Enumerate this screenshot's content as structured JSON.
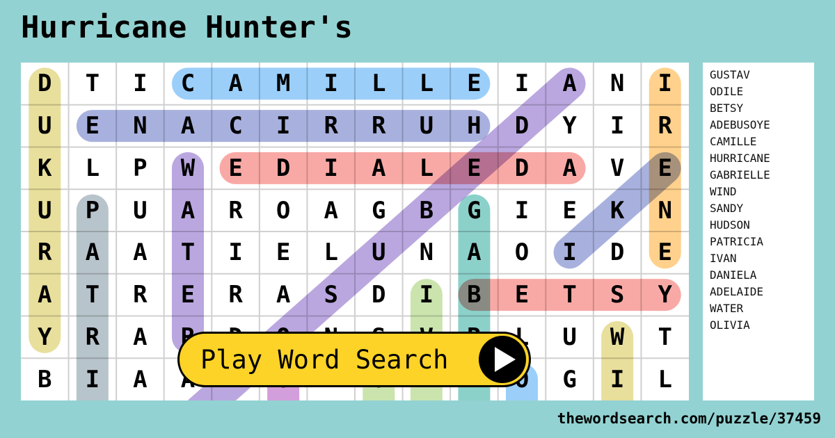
{
  "title": "Hurricane Hunter's",
  "grid": {
    "rows": [
      [
        "D",
        "T",
        "I",
        "C",
        "A",
        "M",
        "I",
        "L",
        "L",
        "E",
        "I",
        "A",
        "N",
        "I"
      ],
      [
        "U",
        "E",
        "N",
        "A",
        "C",
        "I",
        "R",
        "R",
        "U",
        "H",
        "D",
        "Y",
        "I",
        "R"
      ],
      [
        "K",
        "L",
        "P",
        "W",
        "E",
        "D",
        "I",
        "A",
        "L",
        "E",
        "D",
        "A",
        "V",
        "E"
      ],
      [
        "U",
        "P",
        "U",
        "A",
        "R",
        "O",
        "A",
        "G",
        "B",
        "G",
        "I",
        "E",
        "K",
        "N"
      ],
      [
        "R",
        "A",
        "A",
        "T",
        "I",
        "E",
        "L",
        "U",
        "N",
        "A",
        "O",
        "I",
        "D",
        "E"
      ],
      [
        "A",
        "T",
        "R",
        "E",
        "R",
        "A",
        "S",
        "D",
        "I",
        "B",
        "E",
        "T",
        "S",
        "Y"
      ],
      [
        "Y",
        "R",
        "A",
        "R",
        "D",
        "O",
        "N",
        "S",
        "V",
        "R",
        "L",
        "U",
        "W",
        "T"
      ],
      [
        "B",
        "I",
        "A",
        "A",
        "",
        "O",
        "N",
        "O",
        "A",
        "I",
        "O",
        "G",
        "I",
        "L"
      ]
    ]
  },
  "highlights": [
    {
      "word": "CAMILLE",
      "color": "#90caf9",
      "from": [
        0,
        3
      ],
      "to": [
        0,
        9
      ]
    },
    {
      "word": "HURRICANE",
      "color": "#9fa8da",
      "from": [
        1,
        9
      ],
      "to": [
        1,
        1
      ]
    },
    {
      "word": "ADELAIDE",
      "color": "#f8a09b",
      "from": [
        2,
        11
      ],
      "to": [
        2,
        4
      ]
    },
    {
      "word": "BETSY",
      "color": "#f8a09b",
      "from": [
        5,
        9
      ],
      "to": [
        5,
        13
      ]
    },
    {
      "word": "DUKURAY",
      "color": "#e6dc91",
      "from": [
        0,
        0
      ],
      "to": [
        6,
        0
      ]
    },
    {
      "word": "IRENE",
      "color": "#ffcc80",
      "from": [
        0,
        13
      ],
      "to": [
        4,
        13
      ]
    },
    {
      "word": "WATER",
      "color": "#b39ddb",
      "from": [
        2,
        3
      ],
      "to": [
        6,
        3
      ]
    },
    {
      "word": "ADEBUSOYE",
      "color": "#b39ddb",
      "from": [
        0,
        11
      ],
      "to": [
        8,
        3
      ]
    },
    {
      "word": "EKI",
      "color": "#9fa8da",
      "from": [
        2,
        13
      ],
      "to": [
        4,
        11
      ]
    },
    {
      "word": "PATRICIA",
      "color": "#b0bec5",
      "from": [
        3,
        1
      ],
      "to": [
        8,
        1
      ]
    },
    {
      "word": "GABRIELLE",
      "color": "#80cbc4",
      "from": [
        3,
        9
      ],
      "to": [
        8,
        9
      ]
    },
    {
      "word": "IVAN",
      "color": "#c5e1a5",
      "from": [
        5,
        8
      ],
      "to": [
        8,
        8
      ]
    },
    {
      "word": "WIND",
      "color": "#e6dc91",
      "from": [
        6,
        12
      ],
      "to": [
        8,
        12
      ]
    },
    {
      "word": "SANDY",
      "color": "#c5e1a5",
      "from": [
        7,
        7
      ],
      "to": [
        8,
        7
      ]
    },
    {
      "word": "ODILE",
      "color": "#ce93d8",
      "from": [
        7,
        5
      ],
      "to": [
        8,
        5
      ]
    },
    {
      "word": "OLIVIA",
      "color": "#90caf9",
      "from": [
        7,
        10
      ],
      "to": [
        8,
        10
      ]
    }
  ],
  "word_list": [
    "GUSTAV",
    "ODILE",
    "BETSY",
    "ADEBUSOYE",
    "CAMILLE",
    "HURRICANE",
    "GABRIELLE",
    "WIND",
    "SANDY",
    "HUDSON",
    "PATRICIA",
    "IVAN",
    "DANIELA",
    "ADELAIDE",
    "WATER",
    "OLIVIA"
  ],
  "play_button": {
    "label": "Play Word Search",
    "icon": "play-icon"
  },
  "footer_url": "thewordsearch.com/puzzle/37459"
}
